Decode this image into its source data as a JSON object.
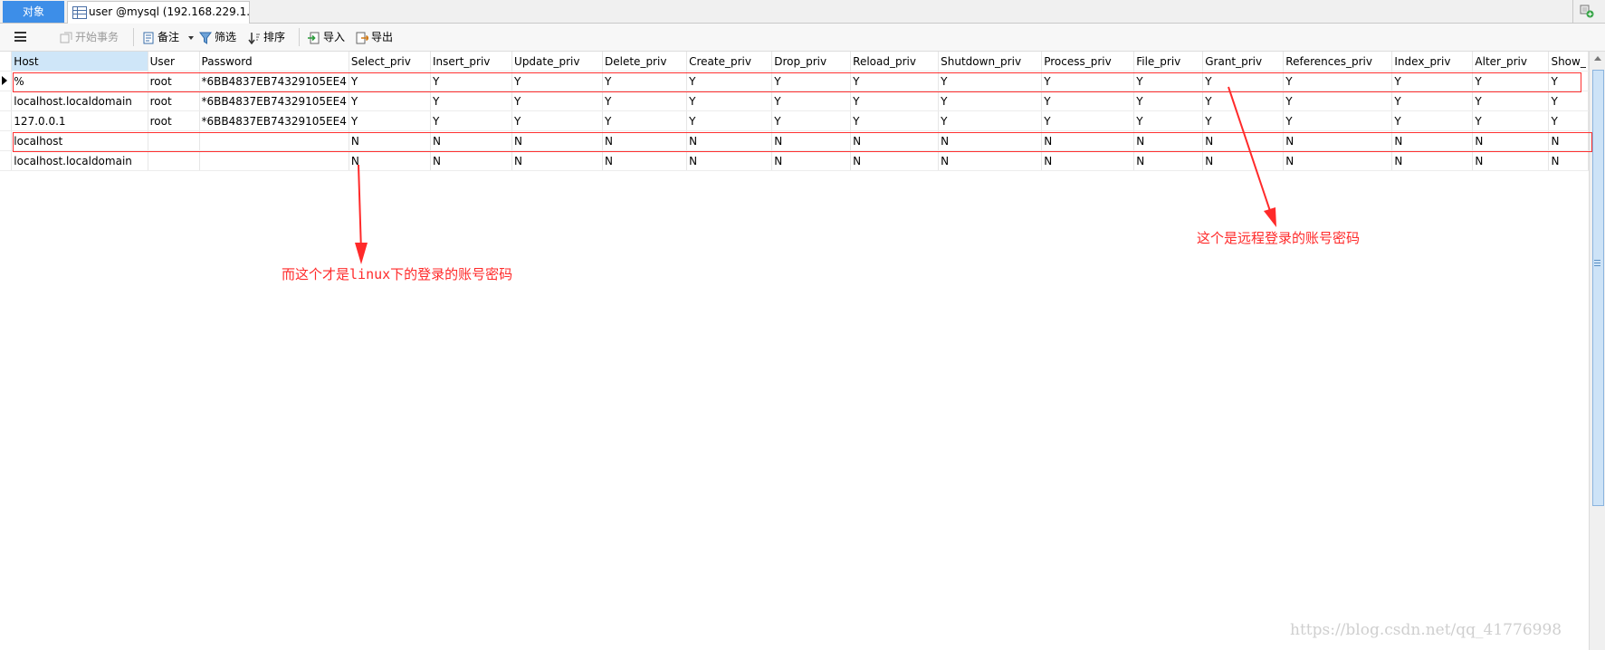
{
  "tabs": {
    "objects_label": "对象",
    "user_tab_label": "user @mysql (192.168.229.1..."
  },
  "toolbar": {
    "begin_transaction": "开始事务",
    "comment": "备注",
    "filter": "筛选",
    "sort": "排序",
    "import": "导入",
    "export": "导出"
  },
  "grid": {
    "columns": [
      "Host",
      "User",
      "Password",
      "Select_priv",
      "Insert_priv",
      "Update_priv",
      "Delete_priv",
      "Create_priv",
      "Drop_priv",
      "Reload_priv",
      "Shutdown_priv",
      "Process_priv",
      "File_priv",
      "Grant_priv",
      "References_priv",
      "Index_priv",
      "Alter_priv",
      "Show_"
    ],
    "rows": [
      [
        "%",
        "root",
        "*6BB4837EB74329105EE4",
        "Y",
        "Y",
        "Y",
        "Y",
        "Y",
        "Y",
        "Y",
        "Y",
        "Y",
        "Y",
        "Y",
        "Y",
        "Y",
        "Y",
        "Y"
      ],
      [
        "localhost.localdomain",
        "root",
        "*6BB4837EB74329105EE4",
        "Y",
        "Y",
        "Y",
        "Y",
        "Y",
        "Y",
        "Y",
        "Y",
        "Y",
        "Y",
        "Y",
        "Y",
        "Y",
        "Y",
        "Y"
      ],
      [
        "127.0.0.1",
        "root",
        "*6BB4837EB74329105EE4",
        "Y",
        "Y",
        "Y",
        "Y",
        "Y",
        "Y",
        "Y",
        "Y",
        "Y",
        "Y",
        "Y",
        "Y",
        "Y",
        "Y",
        "Y"
      ],
      [
        "localhost",
        "",
        "",
        "N",
        "N",
        "N",
        "N",
        "N",
        "N",
        "N",
        "N",
        "N",
        "N",
        "N",
        "N",
        "N",
        "N",
        "N"
      ],
      [
        "localhost.localdomain",
        "",
        "",
        "N",
        "N",
        "N",
        "N",
        "N",
        "N",
        "N",
        "N",
        "N",
        "N",
        "N",
        "N",
        "N",
        "N",
        "N"
      ]
    ]
  },
  "annotations": {
    "remote_note": "这个是远程登录的账号密码",
    "linux_note_prefix": "而这个才是",
    "linux_note_mono": "linux",
    "linux_note_suffix": "下的登录的账号密码",
    "color": "#ff2a2a"
  },
  "watermark": "https://blog.csdn.net/qq_41776998",
  "colors": {
    "objects_tab": "#3d8ee8",
    "selected_header": "#cfe6f8",
    "annotation_red": "#ff3030"
  }
}
